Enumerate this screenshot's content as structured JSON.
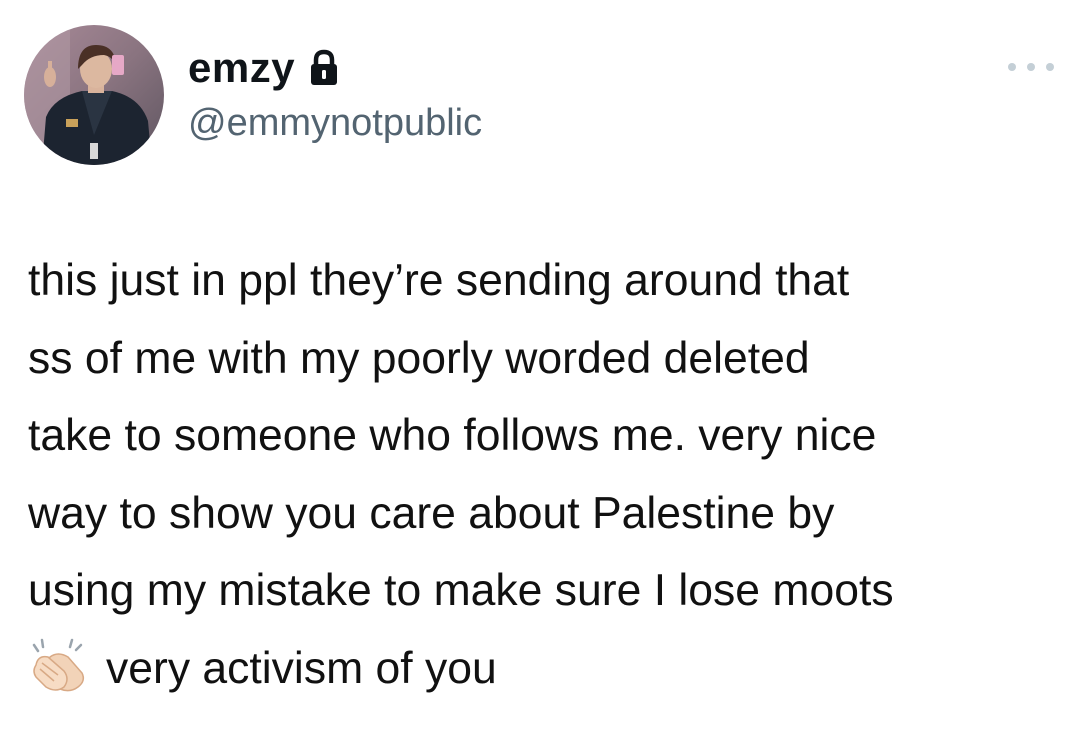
{
  "tweet": {
    "author": {
      "display_name": "emzy",
      "handle": "@emmynotpublic",
      "locked_icon": "lock-icon",
      "avatar_icon": "avatar"
    },
    "more_icon": "more-options-icon",
    "text_lines": [
      "this just in ppl they’re sending around that",
      "ss of me with my poorly worded deleted",
      "take to someone who follows me. very nice",
      "way to show you care about Palestine by",
      "using my mistake to make sure I lose moots",
      "very activism of you"
    ],
    "emoji": "clapping-hands-emoji"
  }
}
